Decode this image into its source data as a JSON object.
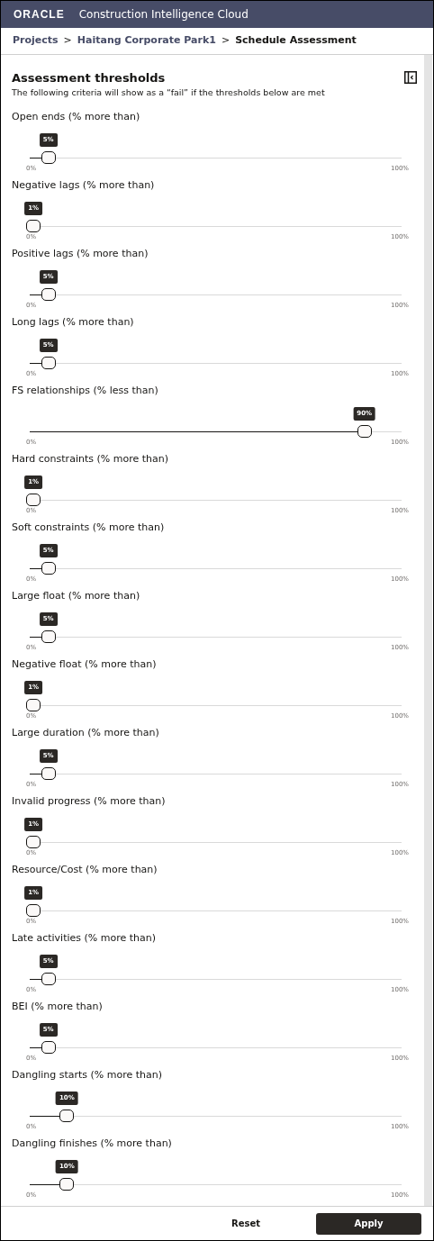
{
  "header": {
    "logo": "ORACLE",
    "app_title": "Construction Intelligence Cloud"
  },
  "breadcrumb": {
    "items": [
      {
        "label": "Projects",
        "current": false
      },
      {
        "label": "Haitang Corporate Park1",
        "current": false
      },
      {
        "label": "Schedule Assessment",
        "current": true
      }
    ],
    "separator": ">"
  },
  "panel": {
    "title": "Assessment thresholds",
    "subtitle": "The following criteria will show as a “fail” if the thresholds below are met",
    "sliders": [
      {
        "label": "Open ends (% more than)",
        "value": "5%",
        "level": 0.05,
        "min": "0%",
        "max": "100%"
      },
      {
        "label": "Negative lags (% more than)",
        "value": "1%",
        "level": 0.01,
        "min": "0%",
        "max": "100%"
      },
      {
        "label": "Positive lags (% more than)",
        "value": "5%",
        "level": 0.05,
        "min": "0%",
        "max": "100%"
      },
      {
        "label": "Long lags (% more than)",
        "value": "5%",
        "level": 0.05,
        "min": "0%",
        "max": "100%"
      },
      {
        "label": "FS relationships (% less than)",
        "value": "90%",
        "level": 0.9,
        "min": "0%",
        "max": "100%"
      },
      {
        "label": "Hard constraints (% more than)",
        "value": "1%",
        "level": 0.01,
        "min": "0%",
        "max": "100%"
      },
      {
        "label": "Soft constraints (% more than)",
        "value": "5%",
        "level": 0.05,
        "min": "0%",
        "max": "100%"
      },
      {
        "label": "Large float (% more than)",
        "value": "5%",
        "level": 0.05,
        "min": "0%",
        "max": "100%"
      },
      {
        "label": "Negative float (% more than)",
        "value": "1%",
        "level": 0.01,
        "min": "0%",
        "max": "100%"
      },
      {
        "label": "Large duration (% more than)",
        "value": "5%",
        "level": 0.05,
        "min": "0%",
        "max": "100%"
      },
      {
        "label": "Invalid progress (% more than)",
        "value": "1%",
        "level": 0.01,
        "min": "0%",
        "max": "100%"
      },
      {
        "label": "Resource/Cost (% more than)",
        "value": "1%",
        "level": 0.01,
        "min": "0%",
        "max": "100%"
      },
      {
        "label": "Late activities (% more than)",
        "value": "5%",
        "level": 0.05,
        "min": "0%",
        "max": "100%"
      },
      {
        "label": "BEI (% more than)",
        "value": "5%",
        "level": 0.05,
        "min": "0%",
        "max": "100%"
      },
      {
        "label": "Dangling starts (% more than)",
        "value": "10%",
        "level": 0.1,
        "min": "0%",
        "max": "100%"
      },
      {
        "label": "Dangling finishes (% more than)",
        "value": "10%",
        "level": 0.1,
        "min": "0%",
        "max": "100%"
      }
    ]
  },
  "footer": {
    "buttons": [
      {
        "label": "Reset",
        "kind": "secondary"
      },
      {
        "label": "Apply",
        "kind": "primary"
      }
    ]
  }
}
